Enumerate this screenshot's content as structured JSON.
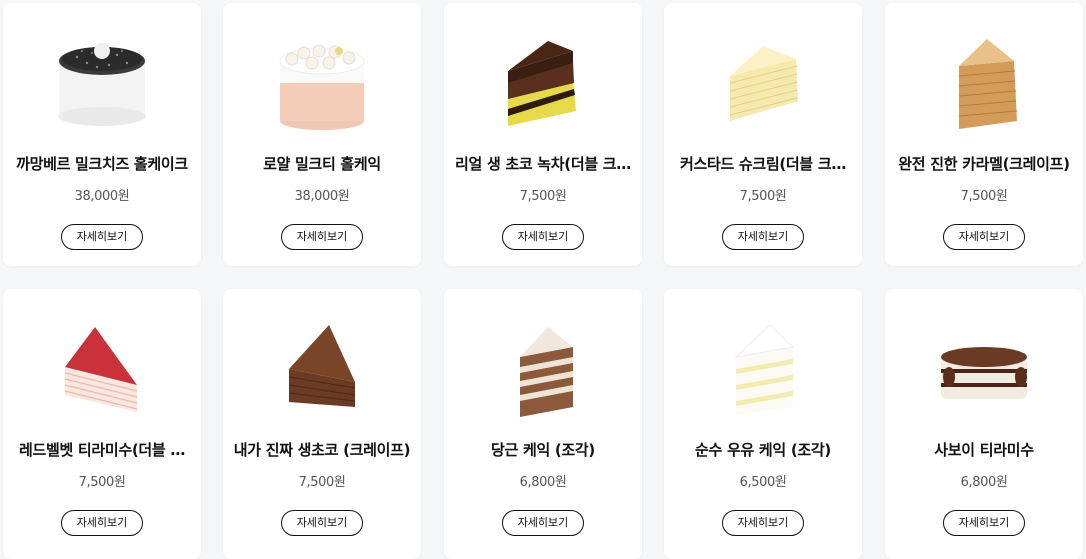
{
  "products": [
    {
      "name": "까망베르 밀크치즈 홀케이크",
      "price": "38,000원",
      "button": "자세히보기",
      "image": "black-sesame-whole-cake"
    },
    {
      "name": "로얄 밀크티 홀케익",
      "price": "38,000원",
      "button": "자세히보기",
      "image": "royal-milk-tea-whole-cake"
    },
    {
      "name": "리얼 생 초코 녹차(더블 크…",
      "price": "7,500원",
      "button": "자세히보기",
      "image": "choco-greentea-slice"
    },
    {
      "name": "커스타드 슈크림(더블 크…",
      "price": "7,500원",
      "button": "자세히보기",
      "image": "custard-crepe-slice"
    },
    {
      "name": "완전 진한 카라멜(크레이프)",
      "price": "7,500원",
      "button": "자세히보기",
      "image": "caramel-crepe-slice"
    },
    {
      "name": "레드벨벳 티라미수(더블 …",
      "price": "7,500원",
      "button": "자세히보기",
      "image": "redvelvet-crepe-slice"
    },
    {
      "name": "내가 진짜 생초코 (크레이프)",
      "price": "7,500원",
      "button": "자세히보기",
      "image": "choco-crepe-slice"
    },
    {
      "name": "당근 케익 (조각)",
      "price": "6,800원",
      "button": "자세히보기",
      "image": "carrot-cake-slice"
    },
    {
      "name": "순수 우유 케익 (조각)",
      "price": "6,500원",
      "button": "자세히보기",
      "image": "milk-cake-slice"
    },
    {
      "name": "사보이 티라미수",
      "price": "6,800원",
      "button": "자세히보기",
      "image": "tiramisu-slice"
    }
  ]
}
